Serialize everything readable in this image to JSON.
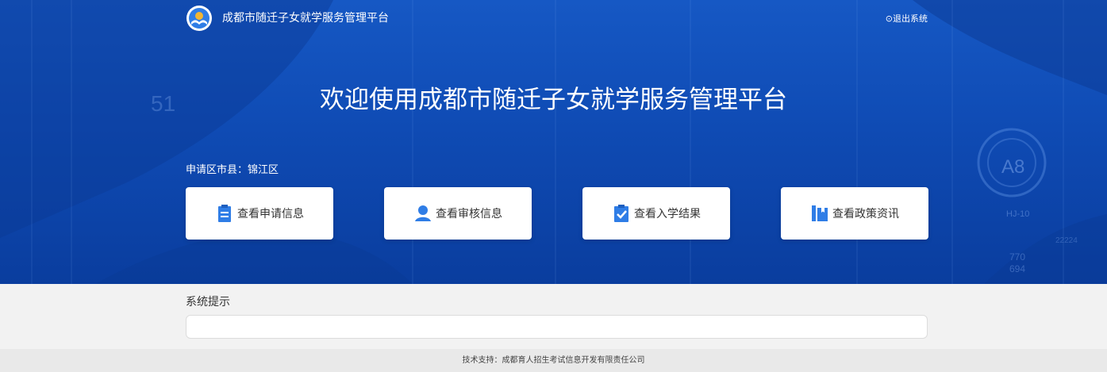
{
  "header": {
    "site_title": "成都市随迁子女就学服务管理平台",
    "logout_label": "⊙退出系统"
  },
  "hero": {
    "welcome": "欢迎使用成都市随迁子女就学服务管理平台",
    "district_label": "申请区市县：",
    "district_value": "锦江区",
    "deco_text": [
      "51",
      "A8",
      "HJ-10",
      "770",
      "694",
      "22224"
    ]
  },
  "actions": [
    {
      "label": "查看申请信息",
      "icon": "clipboard-list-icon"
    },
    {
      "label": "查看审核信息",
      "icon": "person-icon"
    },
    {
      "label": "查看入学结果",
      "icon": "clipboard-check-icon"
    },
    {
      "label": "查看政策资讯",
      "icon": "books-icon"
    }
  ],
  "notice": {
    "title": "系统提示",
    "content": ""
  },
  "footer": {
    "text": "技术支持：成都育人招生考试信息开发有限责任公司"
  },
  "colors": {
    "primary_blue": "#1658c4",
    "icon_blue": "#2f7de6",
    "bg_gray": "#f2f2f2"
  }
}
